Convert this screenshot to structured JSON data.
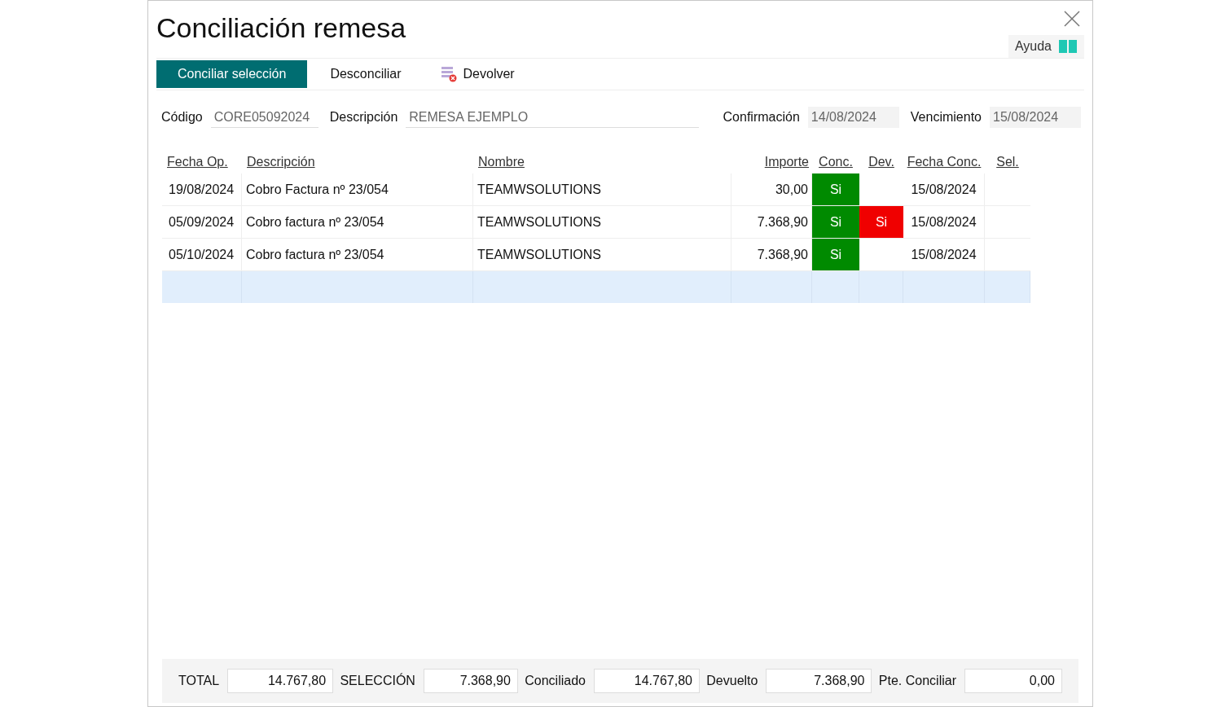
{
  "dialog": {
    "title": "Conciliación remesa",
    "help": "Ayuda"
  },
  "toolbar": [
    {
      "label": "Conciliar selección",
      "kind": "primary"
    },
    {
      "label": "Desconciliar",
      "kind": "plain"
    },
    {
      "label": "Devolver",
      "kind": "icon"
    }
  ],
  "header_fields": [
    {
      "label": "Código",
      "value": "CORE05092024",
      "kind": "underline"
    },
    {
      "label": "Descripción",
      "value": "REMESA EJEMPLO",
      "kind": "wide"
    },
    {
      "label": "Confirmación",
      "value": "14/08/2024",
      "kind": "shaded"
    },
    {
      "label": "Vencimiento",
      "value": "15/08/2024",
      "kind": "shaded"
    }
  ],
  "table": {
    "columns": [
      "Fecha Op.",
      "Descripción",
      "Nombre",
      "Importe",
      "Conc.",
      "Dev.",
      "Fecha Conc.",
      "Sel."
    ],
    "rows": [
      {
        "fecha_op": "19/08/2024",
        "descripcion": "Cobro Factura nº 23/054",
        "nombre": "TEAMWSOLUTIONS",
        "importe": "30,00",
        "conc": "Si",
        "conciliado": true,
        "devuelto": false,
        "fecha_conc": "15/08/2024",
        "selected": false
      },
      {
        "fecha_op": "05/09/2024",
        "descripcion": "Cobro factura nº 23/054",
        "nombre": "TEAMWSOLUTIONS",
        "importe": "7.368,90",
        "conc": "Si",
        "conciliado": true,
        "dev": "Si",
        "devuelto": true,
        "fecha_conc": "15/08/2024",
        "selected": false
      },
      {
        "fecha_op": "05/10/2024",
        "descripcion": "Cobro factura nº 23/054",
        "nombre": "TEAMWSOLUTIONS",
        "importe": "7.368,90",
        "conc": "Si",
        "conciliado": true,
        "devuelto": false,
        "fecha_conc": "15/08/2024",
        "selected": false
      }
    ],
    "empty_row": {
      "selected": true
    }
  },
  "totals": [
    {
      "label": "TOTAL",
      "value": "14.767,80"
    },
    {
      "label": "SELECCIÓN",
      "value": "7.368,90"
    },
    {
      "label": "Conciliado",
      "value": "14.767,80"
    },
    {
      "label": "Devuelto",
      "value": "7.368,90"
    },
    {
      "label": "Pte. Conciliar",
      "value": "0,00"
    }
  ]
}
